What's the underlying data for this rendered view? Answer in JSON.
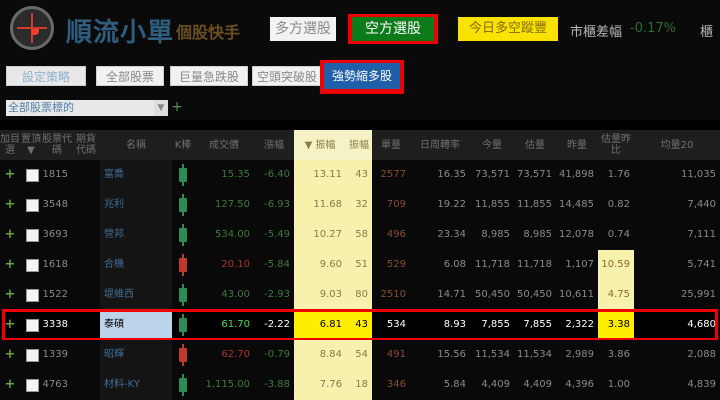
{
  "header": {
    "brand": "順流小單",
    "brand_sub": "個股快手",
    "tabs": [
      {
        "label": "多方選股",
        "active": false
      },
      {
        "label": "空方選股",
        "active": true
      }
    ],
    "today_button": "今日多空蹤豐",
    "cap_label": "市櫃差幅",
    "cap_value": "-0.17%",
    "cut_text": "櫃"
  },
  "strategies": [
    {
      "label": "設定策略",
      "active": false
    },
    {
      "label": "全部股票",
      "active": false
    },
    {
      "label": "巨量急跌股",
      "active": false
    },
    {
      "label": "空頭突破股",
      "active": false
    },
    {
      "label": "強勢縮多股",
      "active": true
    }
  ],
  "selector": {
    "value": "全部股票標的"
  },
  "columns": [
    "加目選",
    "置頂 ▼",
    "股票代碼",
    "期貨代碼",
    "名稱",
    "K棒",
    "成交價",
    "漲幅",
    "▼ 振幅",
    "振幅",
    "單量",
    "日周轉率",
    "今量",
    "估量",
    "昨量",
    "估量昨比",
    "均量20"
  ],
  "rows": [
    {
      "code": "1815",
      "name": "富喬",
      "price": "15.35",
      "chg": "-6.40",
      "amp1": "13.11",
      "amp2": "43",
      "unit": "2577",
      "turn": "16.35",
      "vol": "73,571",
      "est": "73,571",
      "prev": "41,898",
      "ratio": "1.76",
      "avg": "11,035",
      "candle": "green",
      "selected": false,
      "ratio_hl": false
    },
    {
      "code": "3548",
      "name": "兆利",
      "price": "127.50",
      "chg": "-6.93",
      "amp1": "11.68",
      "amp2": "32",
      "unit": "709",
      "turn": "19.22",
      "vol": "11,855",
      "est": "11,855",
      "prev": "14,485",
      "ratio": "0.82",
      "avg": "7,440",
      "candle": "green",
      "selected": false,
      "ratio_hl": false
    },
    {
      "code": "3693",
      "name": "營邦",
      "price": "534.00",
      "chg": "-5.49",
      "amp1": "10.27",
      "amp2": "58",
      "unit": "496",
      "turn": "23.34",
      "vol": "8,985",
      "est": "8,985",
      "prev": "12,078",
      "ratio": "0.74",
      "avg": "7,111",
      "candle": "green",
      "selected": false,
      "ratio_hl": false
    },
    {
      "code": "1618",
      "name": "合機",
      "price": "20.10",
      "chg": "-5.84",
      "amp1": "9.60",
      "amp2": "51",
      "unit": "529",
      "turn": "6.08",
      "vol": "11,718",
      "est": "11,718",
      "prev": "1,107",
      "ratio": "10.59",
      "avg": "5,741",
      "candle": "red",
      "selected": false,
      "ratio_hl": true
    },
    {
      "code": "1522",
      "name": "堤維西",
      "price": "43.00",
      "chg": "-2.93",
      "amp1": "9.03",
      "amp2": "80",
      "unit": "2510",
      "turn": "14.71",
      "vol": "50,450",
      "est": "50,450",
      "prev": "10,611",
      "ratio": "4.75",
      "avg": "25,991",
      "candle": "green",
      "selected": false,
      "ratio_hl": true
    },
    {
      "code": "3338",
      "name": "泰碩",
      "price": "61.70",
      "chg": "-2.22",
      "amp1": "6.81",
      "amp2": "43",
      "unit": "534",
      "turn": "8.93",
      "vol": "7,855",
      "est": "7,855",
      "prev": "2,322",
      "ratio": "3.38",
      "avg": "4,680",
      "candle": "green",
      "selected": true,
      "ratio_hl": true
    },
    {
      "code": "1339",
      "name": "昭輝",
      "price": "62.70",
      "chg": "-0.79",
      "amp1": "8.84",
      "amp2": "54",
      "unit": "491",
      "turn": "15.56",
      "vol": "11,534",
      "est": "11,534",
      "prev": "2,989",
      "ratio": "3.86",
      "avg": "2,088",
      "candle": "red",
      "selected": false,
      "ratio_hl": false
    },
    {
      "code": "4763",
      "name": "材料-KY",
      "price": "1,115.00",
      "chg": "-3.88",
      "amp1": "7.76",
      "amp2": "18",
      "unit": "346",
      "turn": "5.84",
      "vol": "4,409",
      "est": "4,409",
      "prev": "4,396",
      "ratio": "1.00",
      "avg": "4,839",
      "candle": "green",
      "selected": false,
      "ratio_hl": false
    }
  ],
  "colors": {
    "active_green": "#0d7b1a",
    "active_blue": "#1f5ea8",
    "highlight_red": "#e00000",
    "amp_bg": "#f7f1ae",
    "up_red": "#c0392b",
    "down_green": "#2e8b57"
  }
}
